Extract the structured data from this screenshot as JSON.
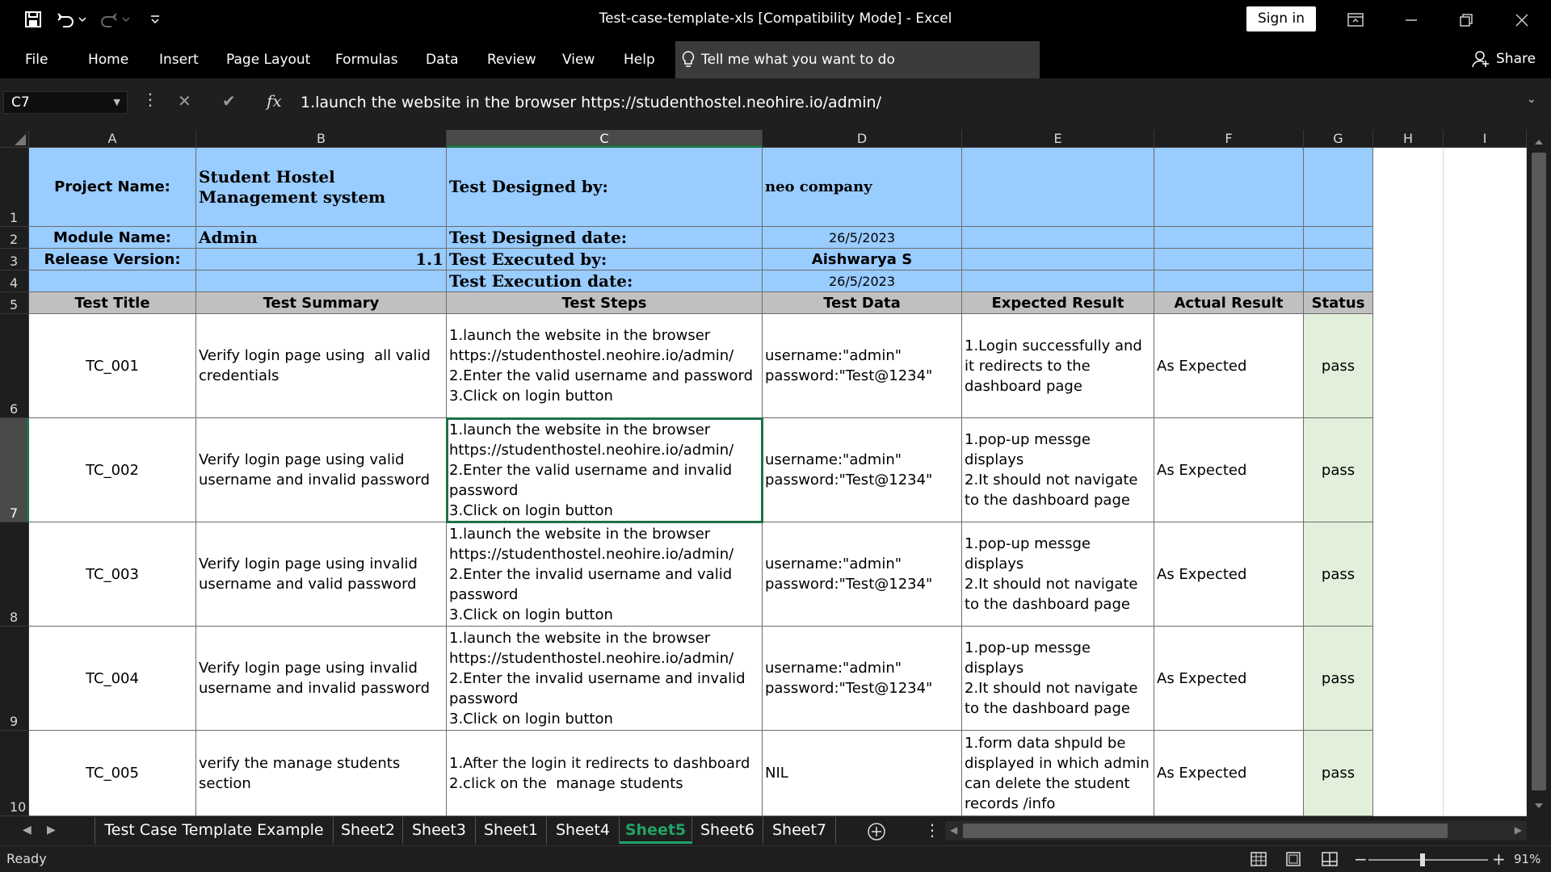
{
  "window": {
    "title": "Test-case-template-xls  [Compatibility Mode]  -  Excel",
    "sign_in": "Sign in"
  },
  "ribbon": {
    "tabs": [
      "File",
      "Home",
      "Insert",
      "Page Layout",
      "Formulas",
      "Data",
      "Review",
      "View",
      "Help"
    ],
    "tell_me": "Tell me what you want to do",
    "share": "Share"
  },
  "formula_bar": {
    "name_box": "C7",
    "fx": "fx",
    "formula": "1.launch the website in the browser https://studenthostel.neohire.io/admin/"
  },
  "columns": [
    "A",
    "B",
    "C",
    "D",
    "E",
    "F",
    "G",
    "H",
    "I"
  ],
  "rows": [
    "1",
    "2",
    "3",
    "4",
    "5",
    "6",
    "7",
    "8",
    "9",
    "10"
  ],
  "sheet": {
    "project_label": "Project Name:",
    "project_value": "Student Hostel Management system",
    "designed_by_label": "Test Designed by:",
    "designed_by_value": "neo company",
    "module_label": "Module Name:",
    "module_value": "Admin",
    "designed_date_label": "Test Designed date:",
    "designed_date_value": "26/5/2023",
    "release_label": "Release Version:",
    "release_value": "1.1",
    "executed_by_label": "Test Executed by:",
    "executed_by_value": "Aishwarya S",
    "execution_date_label": "Test Execution date:",
    "execution_date_value": "26/5/2023",
    "headers": [
      "Test Title",
      "Test Summary",
      "Test Steps",
      "Test Data",
      "Expected Result",
      "Actual Result",
      "Status"
    ],
    "cases": [
      {
        "title": "TC_001",
        "summary": "Verify login page using  all valid credentials",
        "steps": "1.launch the website in the browser https://studenthostel.neohire.io/admin/\n2.Enter the valid username and password\n3.Click on login button",
        "data": "username:\"admin\"\npassword:\"Test@1234\"",
        "expected": "1.Login successfully and it redirects to the dashboard page",
        "actual": "As Expected",
        "status": "pass"
      },
      {
        "title": "TC_002",
        "summary": "Verify login page using valid username and invalid password",
        "steps": "1.launch the website in the browser https://studenthostel.neohire.io/admin/\n2.Enter the valid username and invalid password\n3.Click on login button",
        "data": "username:\"admin\"\npassword:\"Test@1234\"",
        "expected": "1.pop-up messge displays\n2.It should not navigate to the dashboard page",
        "actual": "As Expected",
        "status": "pass"
      },
      {
        "title": "TC_003",
        "summary": "Verify login page using invalid username and valid password",
        "steps": "1.launch the website in the browser https://studenthostel.neohire.io/admin/\n2.Enter the invalid username and valid password\n3.Click on login button",
        "data": "username:\"admin\"\npassword:\"Test@1234\"",
        "expected": "1.pop-up messge displays\n2.It should not navigate to the dashboard page",
        "actual": "As Expected",
        "status": "pass"
      },
      {
        "title": "TC_004",
        "summary": "Verify login page using invalid username and invalid password",
        "steps": "1.launch the website in the browser https://studenthostel.neohire.io/admin/\n2.Enter the invalid username and invalid password\n3.Click on login button",
        "data": "username:\"admin\"\npassword:\"Test@1234\"",
        "expected": "1.pop-up messge displays\n2.It should not navigate to the dashboard page",
        "actual": "As Expected",
        "status": "pass"
      },
      {
        "title": "TC_005",
        "summary": "verify the manage students section",
        "steps": "1.After the login it redirects to dashboard\n2.click on the  manage students",
        "data": "NIL",
        "expected": "1.form data shpuld be displayed in which admin can delete the student records /info",
        "actual": "As Expected",
        "status": "pass"
      }
    ]
  },
  "sheet_tabs": [
    "Test Case Template Example",
    "Sheet2",
    "Sheet3",
    "Sheet1",
    "Sheet4",
    "Sheet5",
    "Sheet6",
    "Sheet7"
  ],
  "active_sheet": "Sheet5",
  "status_bar": {
    "ready": "Ready",
    "zoom": "91%"
  },
  "colors": {
    "header_blue": "#99ccff",
    "header_grey": "#c0c0c0",
    "pass_green": "#e2efda",
    "excel_green": "#21a366"
  }
}
